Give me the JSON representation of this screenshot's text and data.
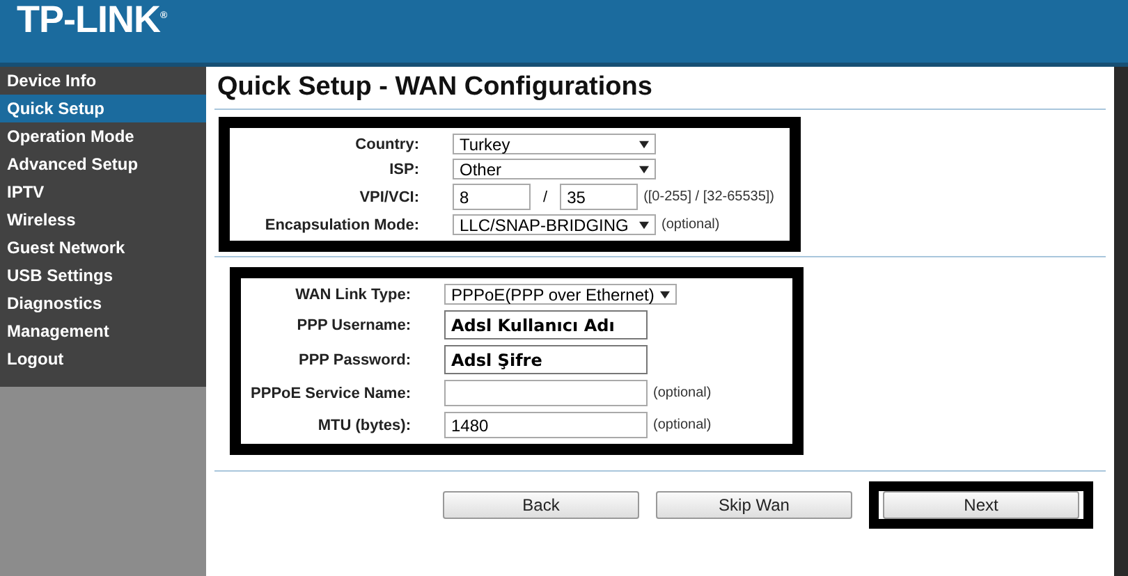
{
  "logo": {
    "text": "TP-LINK",
    "mark": "®"
  },
  "sidebar": {
    "items": [
      {
        "label": "Device Info",
        "selected": false
      },
      {
        "label": "Quick Setup",
        "selected": true
      },
      {
        "label": "Operation Mode",
        "selected": false
      },
      {
        "label": "Advanced Setup",
        "selected": false
      },
      {
        "label": "IPTV",
        "selected": false
      },
      {
        "label": "Wireless",
        "selected": false
      },
      {
        "label": "Guest Network",
        "selected": false
      },
      {
        "label": "USB Settings",
        "selected": false
      },
      {
        "label": "Diagnostics",
        "selected": false
      },
      {
        "label": "Management",
        "selected": false
      },
      {
        "label": "Logout",
        "selected": false
      }
    ]
  },
  "page_title": "Quick Setup - WAN Configurations",
  "sections": [
    {
      "rows": [
        {
          "label": "Country:",
          "kind": "select",
          "value": "Turkey"
        },
        {
          "label": "ISP:",
          "kind": "select",
          "value": "Other"
        },
        {
          "label": "VPI/VCI:",
          "kind": "pair",
          "value": "8",
          "separator": "/",
          "value2": "35",
          "note": "([0-255] / [32-65535])"
        },
        {
          "label": "Encapsulation Mode:",
          "kind": "select",
          "value": "LLC/SNAP-BRIDGING",
          "note": "(optional)"
        }
      ]
    },
    {
      "rows": [
        {
          "label": "WAN Link Type:",
          "kind": "select",
          "value": "PPPoE(PPP over Ethernet)"
        },
        {
          "label": "PPP Username:",
          "kind": "bold-text",
          "value": "Adsl Kullanıcı Adı"
        },
        {
          "label": "PPP Password:",
          "kind": "bold-text",
          "value": "Adsl Şifre"
        },
        {
          "label": "PPPoE Service Name:",
          "kind": "text",
          "value": "",
          "note": "(optional)"
        },
        {
          "label": "MTU (bytes):",
          "kind": "text",
          "value": "1480",
          "note": "(optional)"
        }
      ]
    }
  ],
  "buttons": [
    {
      "label": "Back",
      "highlighted": false
    },
    {
      "label": "Skip Wan",
      "highlighted": false
    },
    {
      "label": "Next",
      "highlighted": true
    }
  ]
}
